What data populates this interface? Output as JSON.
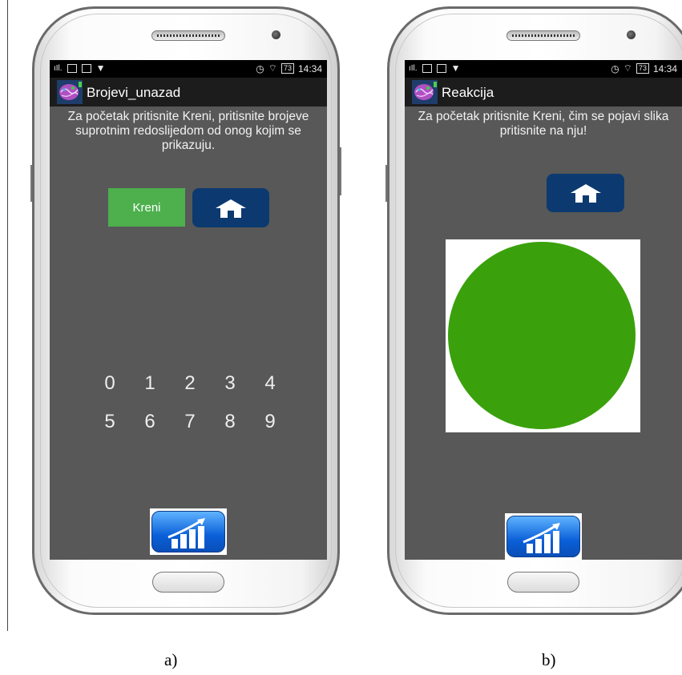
{
  "captions": [
    "a)",
    "b)"
  ],
  "status_bar": {
    "time": "14:34",
    "battery": "73"
  },
  "screen_a": {
    "app_title": "Brojevi_unazad",
    "instruction": "Za početak pritisnite Kreni, pritisnite brojeve suprotnim redoslijedom od onog kojim se prikazuju.",
    "start_button": "Kreni",
    "digits_row1": [
      "0",
      "1",
      "2",
      "3",
      "4"
    ],
    "digits_row2": [
      "5",
      "6",
      "7",
      "8",
      "9"
    ]
  },
  "screen_b": {
    "app_title": "Reakcija",
    "instruction": "Za početak pritisnite Kreni, čim se pojavi slika pritisnite na nju!",
    "target_color": "#3aa10c"
  },
  "colors": {
    "screen_bg": "#585858",
    "kreni_green": "#4db04d",
    "home_blue": "#0c3a70"
  },
  "icons": {
    "home": "home-icon",
    "stats": "stats-chart-icon",
    "app": "brain-app-icon"
  }
}
